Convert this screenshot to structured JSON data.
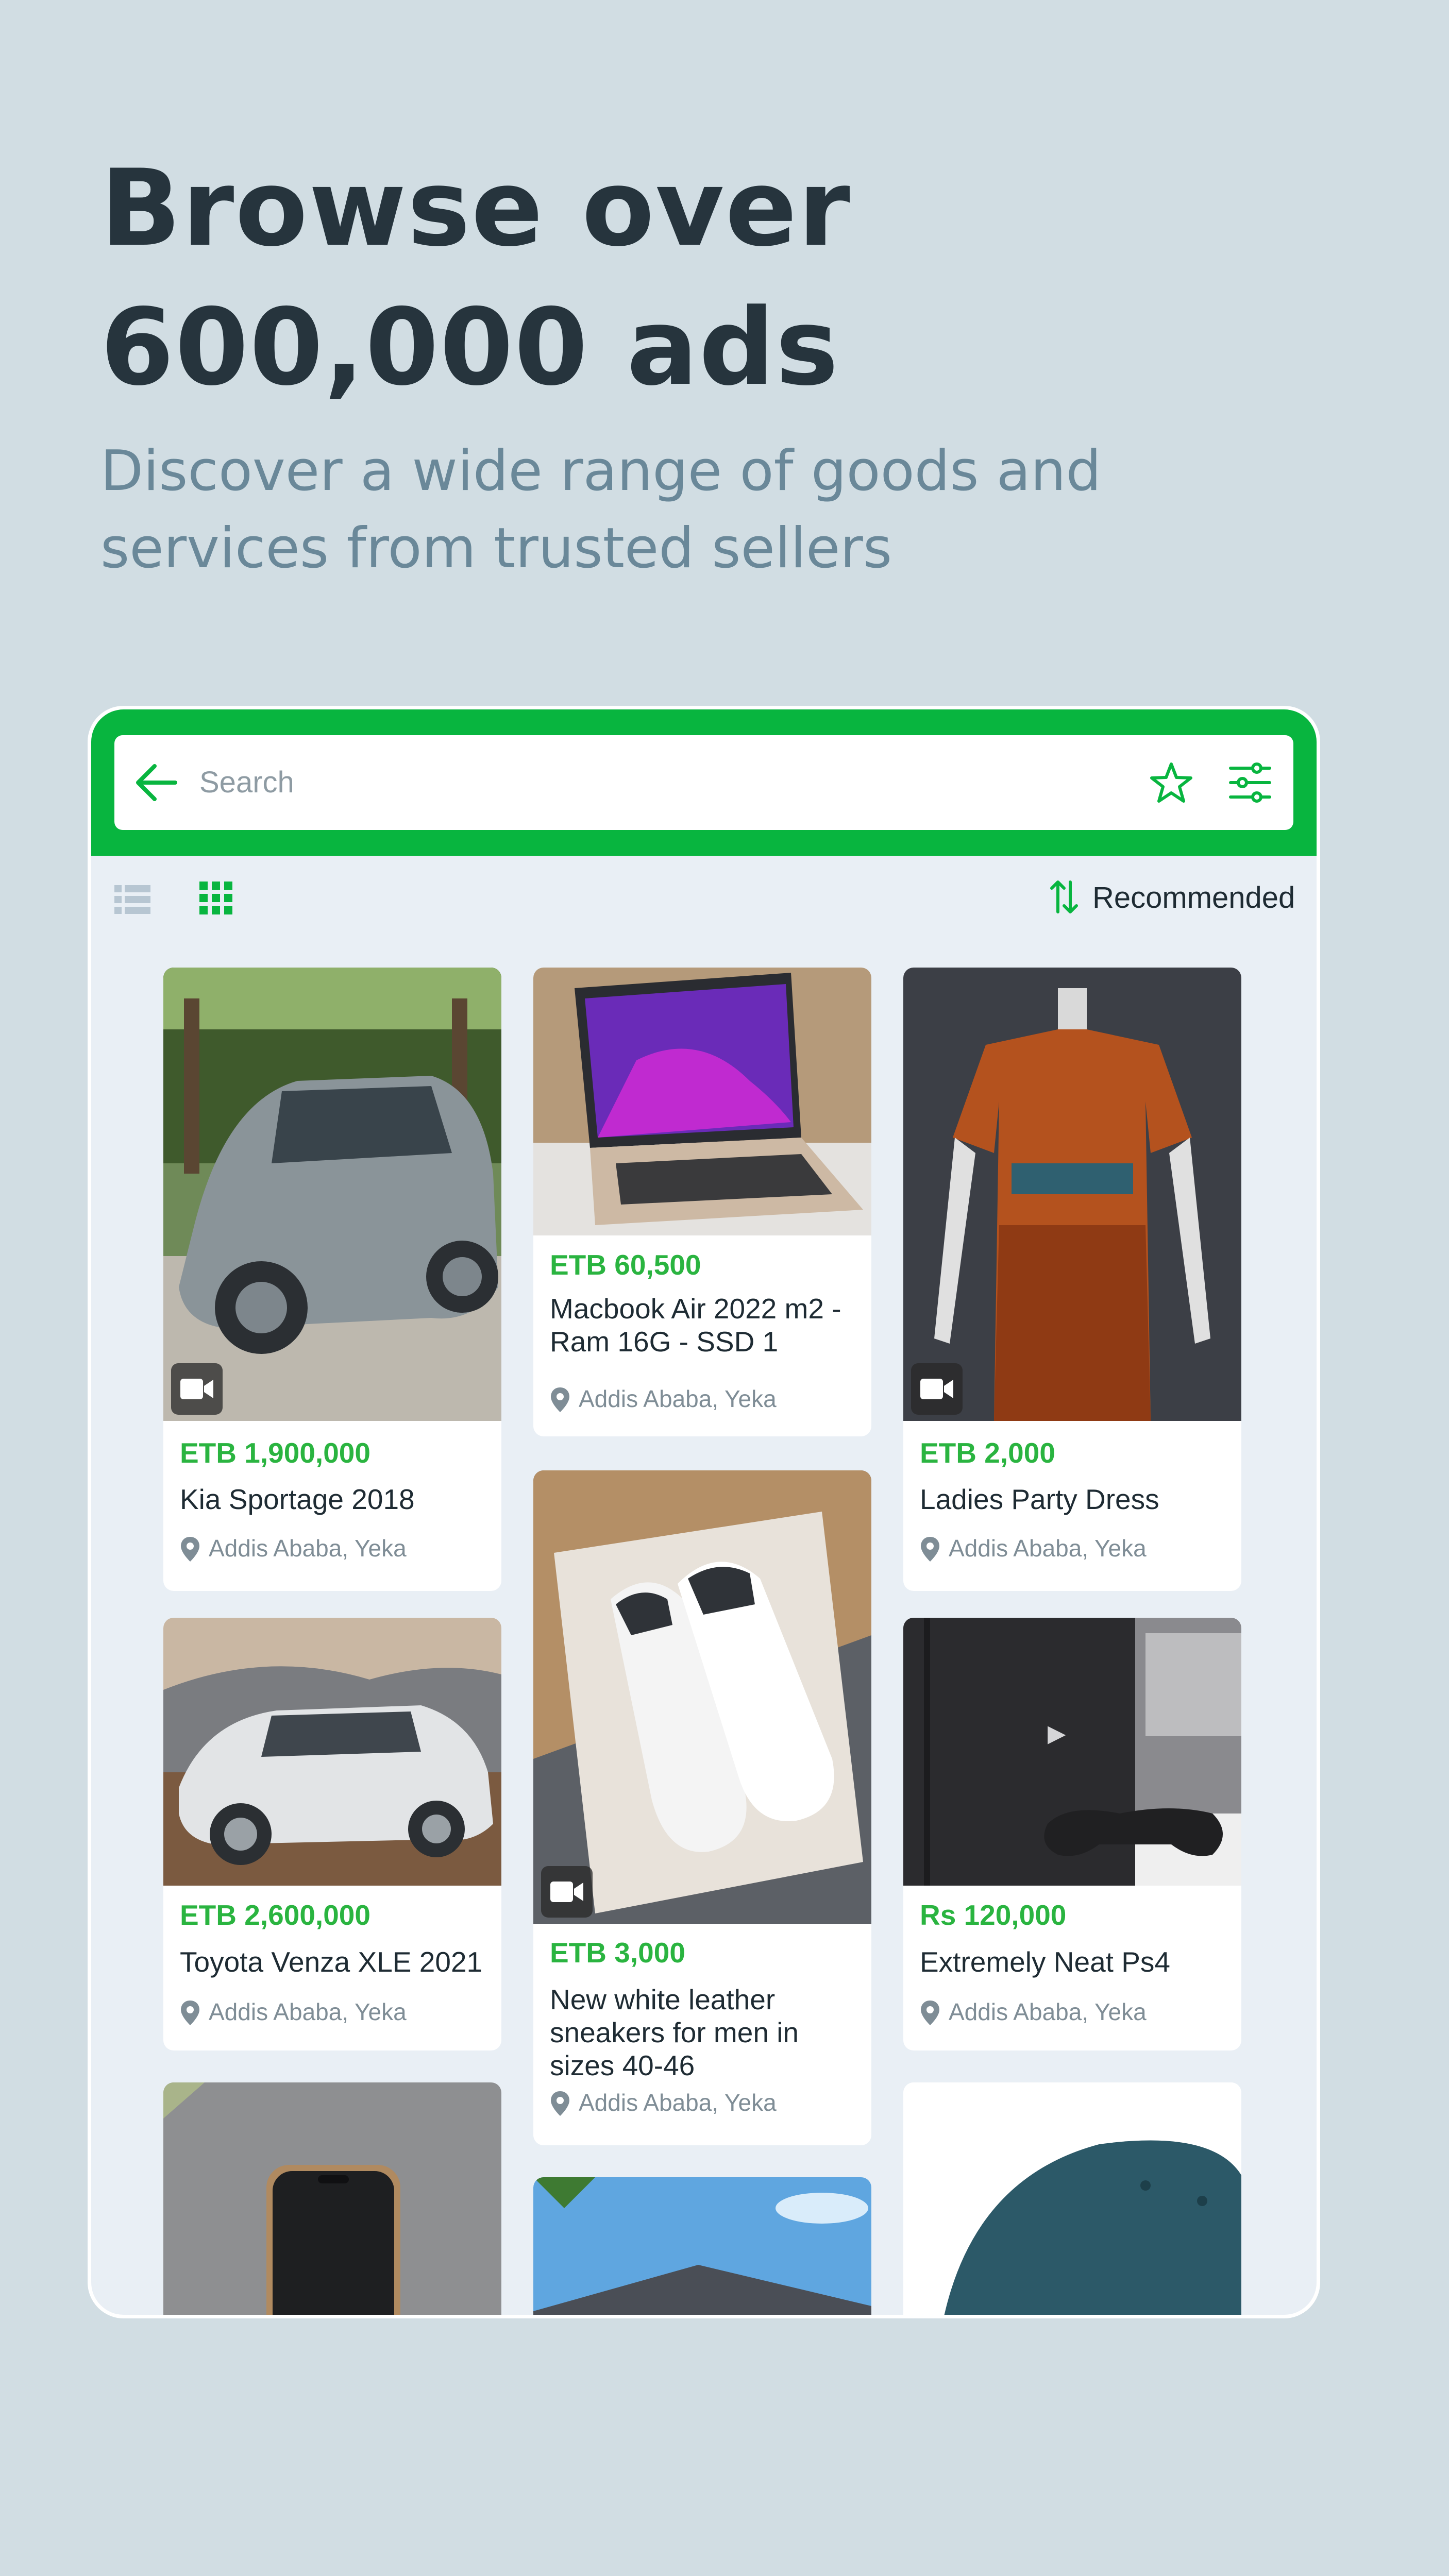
{
  "hero": {
    "headline_line1": "Browse over",
    "headline_line2": "600,000 ads",
    "subline_line1": "Discover a wide range of goods and",
    "subline_line2": "services from trusted sellers"
  },
  "search": {
    "placeholder": "Search"
  },
  "sort": {
    "label": "Recommended"
  },
  "colors": {
    "brand_green": "#08b53f",
    "price_green": "#2ab440",
    "background": "#d1dde3"
  },
  "listings": [
    {
      "price": "ETB 1,900,000",
      "title": "Kia Sportage 2018",
      "location": "Addis Ababa, Yeka",
      "has_video": true
    },
    {
      "price": "ETB 60,500",
      "title": "Macbook Air 2022 m2 - Ram 16G - SSD 1",
      "location": "Addis Ababa, Yeka",
      "has_video": false
    },
    {
      "price": "ETB 2,000",
      "title": "Ladies Party Dress",
      "location": "Addis Ababa, Yeka",
      "has_video": true
    },
    {
      "price": "ETB 2,600,000",
      "title": "Toyota Venza XLE 2021",
      "location": "Addis Ababa, Yeka",
      "has_video": false
    },
    {
      "price": "ETB 3,000",
      "title": "New white leather sneakers for men in sizes 40-46",
      "location": "Addis Ababa, Yeka",
      "has_video": true
    },
    {
      "price": "Rs 120,000",
      "title": "Extremely Neat Ps4",
      "location": "Addis Ababa, Yeka",
      "has_video": false
    }
  ]
}
